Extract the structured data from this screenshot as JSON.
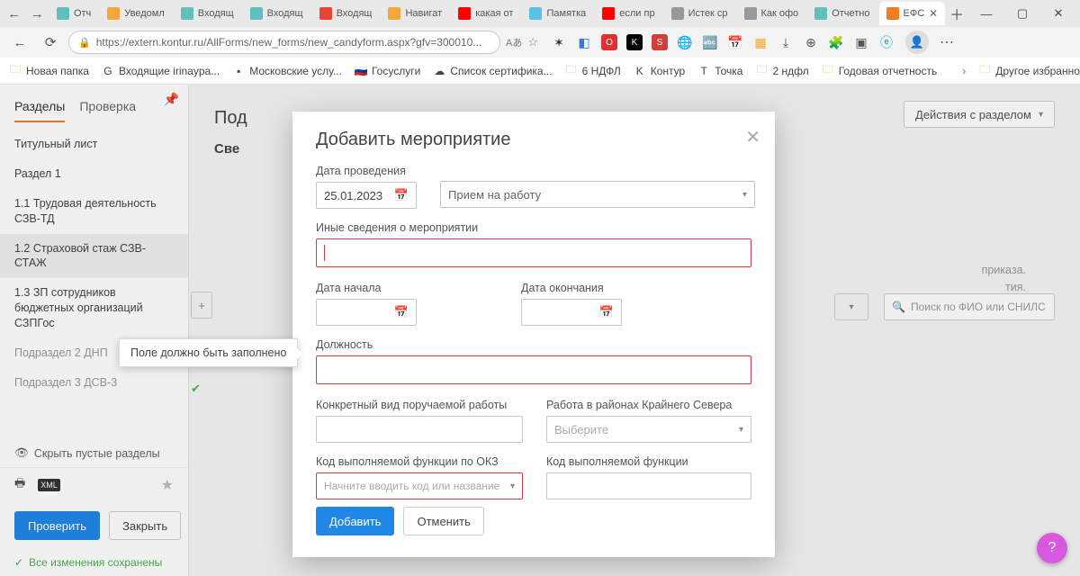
{
  "browser": {
    "tabs": [
      {
        "label": "Отч",
        "fav": "#5fbfbf"
      },
      {
        "label": "Уведомл",
        "fav": "#f3a73b"
      },
      {
        "label": "Входящ",
        "fav": "#5fbfbf"
      },
      {
        "label": "Входящ",
        "fav": "#5fbfbf"
      },
      {
        "label": "Входящ",
        "fav": "#ea4335"
      },
      {
        "label": "Навигат",
        "fav": "#f3a73b"
      },
      {
        "label": "какая от",
        "fav": "#ff0000"
      },
      {
        "label": "Памятка",
        "fav": "#5cc1e6"
      },
      {
        "label": "если пр",
        "fav": "#ff0000"
      },
      {
        "label": "Истек ср",
        "fav": "#999"
      },
      {
        "label": "Как офо",
        "fav": "#999"
      },
      {
        "label": "Отчетно",
        "fav": "#5fbfbf"
      },
      {
        "label": "ЕФС",
        "fav": "#f47b20",
        "active": true
      }
    ],
    "url": "https://extern.kontur.ru/AllForms/new_forms/new_candyform.aspx?gfv=300010...",
    "bookmarks": [
      {
        "label": "Новая папка",
        "icon": "folder"
      },
      {
        "label": "Входящие irinayра...",
        "icon": "g"
      },
      {
        "label": "Московские услу...",
        "icon": "red"
      },
      {
        "label": "Госуслуги",
        "icon": "flag"
      },
      {
        "label": "Список сертифика...",
        "icon": "cloud"
      },
      {
        "label": "6 НДФЛ",
        "icon": "folder"
      },
      {
        "label": "Контур",
        "icon": "k"
      },
      {
        "label": "Точка",
        "icon": "t"
      },
      {
        "label": "2 ндфл",
        "icon": "folder"
      },
      {
        "label": "Годовая отчетность",
        "icon": "folder"
      }
    ],
    "other_bookmarks": "Другое избранное"
  },
  "sidebar": {
    "tabs": {
      "sections": "Разделы",
      "check": "Проверка"
    },
    "items": [
      "Титульный лист",
      "Раздел 1",
      "1.1 Трудовая деятельность СЗВ-ТД",
      "1.2 Страховой стаж СЗВ-СТАЖ",
      "1.3 ЗП сотрудников бюджетных организаций СЗПГос",
      "Подраздел 2 ДНП",
      "Подраздел 3 ДСВ-3"
    ],
    "hide": "Скрыть пустые разделы",
    "check_btn": "Проверить",
    "close_btn": "Закрыть",
    "status": "Все изменения сохранены"
  },
  "main": {
    "actions_btn": "Действия с разделом",
    "heading1": "Под",
    "heading2": "Све",
    "side_text1": "приказа.",
    "side_text2": "тия.",
    "search_placeholder": "Поиск по ФИО или СНИЛС"
  },
  "tooltip": "Поле должно быть заполнено",
  "modal": {
    "title": "Добавить мероприятие",
    "date_label": "Дата проведения",
    "date_value": "25.01.2023",
    "type_value": "Прием на работу",
    "other_info_label": "Иные сведения о мероприятии",
    "start_label": "Дата начала",
    "end_label": "Дата окончания",
    "position_label": "Должность",
    "specific_label": "Конкретный вид поручаемой работы",
    "north_label": "Работа в районах Крайнего Севера",
    "north_placeholder": "Выберите",
    "okz_label": "Код выполняемой функции по ОКЗ",
    "okz_placeholder": "Начните вводить код или название",
    "func_label": "Код выполняемой функции",
    "add_btn": "Добавить",
    "cancel_btn": "Отменить"
  },
  "fab": "?"
}
